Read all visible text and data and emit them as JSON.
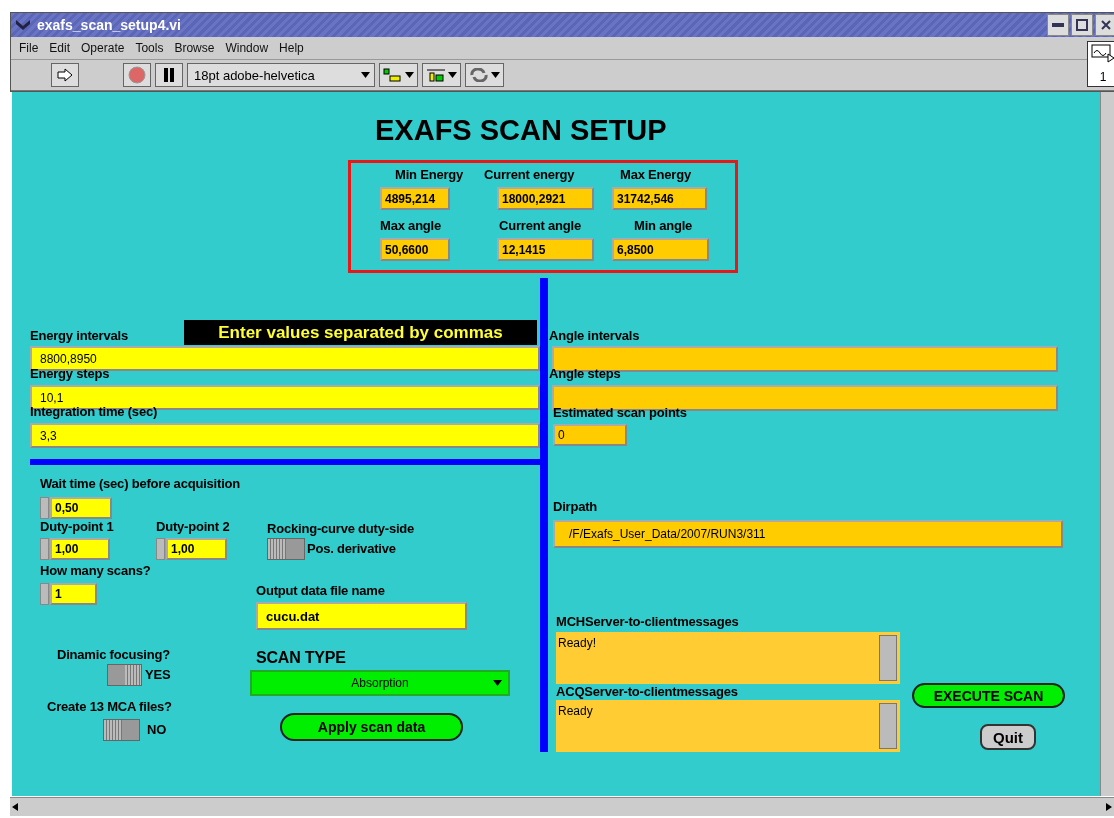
{
  "window": {
    "title": "exafs_scan_setup4.vi"
  },
  "menu": [
    "File",
    "Edit",
    "Operate",
    "Tools",
    "Browse",
    "Window",
    "Help"
  ],
  "toolbar": {
    "font": "18pt adobe-helvetica",
    "vi_number": "1"
  },
  "panel_title": "EXAFS SCAN SETUP",
  "readouts": [
    {
      "label": "Min Energy",
      "value": "4895,214"
    },
    {
      "label": "Current energy",
      "value": "18000,2921"
    },
    {
      "label": "Max Energy",
      "value": "31742,546"
    },
    {
      "label": "Max angle",
      "value": "50,6600"
    },
    {
      "label": "Current angle",
      "value": "12,1415"
    },
    {
      "label": "Min angle",
      "value": "6,8500"
    }
  ],
  "hint": "Enter values separated by commas",
  "energy_inputs": [
    {
      "label": "Energy intervals",
      "value": "8800,8950"
    },
    {
      "label": "Energy steps",
      "value": "10,1"
    },
    {
      "label": "Integration time (sec)",
      "value": "3,3"
    }
  ],
  "angle_inputs": [
    {
      "label": "Angle intervals"
    },
    {
      "label": "Angle steps"
    }
  ],
  "estimated_points": {
    "label": "Estimated scan points",
    "value": "0"
  },
  "numerics": [
    {
      "label": "Wait time (sec) before acquisition",
      "value": "0,50"
    },
    {
      "label": "Duty-point 1",
      "value": "1,00"
    },
    {
      "label": "Duty-point 2",
      "value": "1,00"
    },
    {
      "label": "How many scans?",
      "value": "1"
    }
  ],
  "switches": [
    {
      "label": "Rocking-curve duty-side",
      "text": "Pos. derivative",
      "on": false
    },
    {
      "label": "Dinamic focusing?",
      "text": "YES",
      "on": true
    },
    {
      "label": "Create 13 MCA files?",
      "text": "NO",
      "on": false
    }
  ],
  "output_file": {
    "label": "Output data file name",
    "value": "cucu.dat"
  },
  "scan_type": {
    "label": "SCAN TYPE",
    "value": "Absorption"
  },
  "apply_button": "Apply scan data",
  "dirpath": {
    "label": "Dirpath",
    "value": "/F/Exafs_User_Data/2007/RUN3/311"
  },
  "messages": [
    {
      "label": "MCHServer-to-clientmessages",
      "text": "Ready!"
    },
    {
      "label": "ACQServer-to-clientmessages",
      "text": "Ready"
    }
  ],
  "execute_button": "EXECUTE SCAN",
  "quit_button": "Quit"
}
